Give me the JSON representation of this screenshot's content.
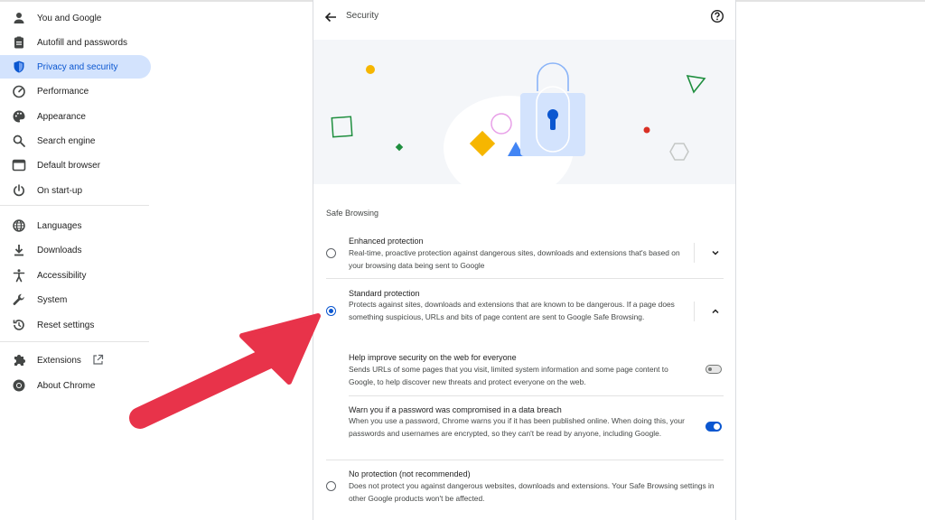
{
  "sidebar": {
    "items": [
      {
        "label": "You and Google",
        "icon": "person-icon"
      },
      {
        "label": "Autofill and passwords",
        "icon": "clipboard-icon"
      },
      {
        "label": "Privacy and security",
        "icon": "shield-icon",
        "active": true
      },
      {
        "label": "Performance",
        "icon": "gauge-icon"
      },
      {
        "label": "Appearance",
        "icon": "palette-icon"
      },
      {
        "label": "Search engine",
        "icon": "search-icon"
      },
      {
        "label": "Default browser",
        "icon": "browser-icon"
      },
      {
        "label": "On start-up",
        "icon": "power-icon"
      },
      {
        "label": "Languages",
        "icon": "globe-icon"
      },
      {
        "label": "Downloads",
        "icon": "download-icon"
      },
      {
        "label": "Accessibility",
        "icon": "accessibility-icon"
      },
      {
        "label": "System",
        "icon": "wrench-icon"
      },
      {
        "label": "Reset settings",
        "icon": "history-icon"
      },
      {
        "label": "Extensions",
        "icon": "puzzle-icon"
      },
      {
        "label": "About Chrome",
        "icon": "chrome-icon"
      }
    ]
  },
  "header": {
    "title": "Security"
  },
  "safe_browsing": {
    "section_title": "Safe Browsing",
    "enhanced": {
      "title": "Enhanced protection",
      "desc": "Real-time, proactive protection against dangerous sites, downloads and extensions that's based on your browsing data being sent to Google"
    },
    "standard": {
      "title": "Standard protection",
      "desc": "Protects against sites, downloads and extensions that are known to be dangerous. If a page does something suspicious, URLs and bits of page content are sent to Google Safe Browsing."
    },
    "help_improve": {
      "title": "Help improve security on the web for everyone",
      "desc": "Sends URLs of some pages that you visit, limited system information and some page content to Google, to help discover new threats and protect everyone on the web."
    },
    "warn_password": {
      "title": "Warn you if a password was compromised in a data breach",
      "desc": "When you use a password, Chrome warns you if it has been published online. When doing this, your passwords and usernames are encrypted, so they can't be read by anyone, including Google."
    },
    "no_protection": {
      "title": "No protection (not recommended)",
      "desc": "Does not protect you against dangerous websites, downloads and extensions. Your Safe Browsing settings in other Google products won't be affected."
    }
  },
  "colors": {
    "accent": "#0b57d0",
    "active_bg": "#d3e3fd",
    "annotation_arrow": "#e8334a"
  }
}
